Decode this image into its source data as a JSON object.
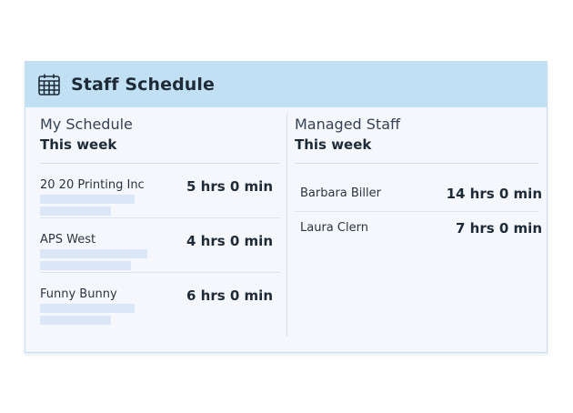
{
  "header": {
    "title": "Staff Schedule",
    "icon": "calendar-icon"
  },
  "my_schedule": {
    "title": "My Schedule",
    "subtitle": "This week",
    "items": [
      {
        "name": "20 20 Printing Inc",
        "time": "5 hrs 0 min"
      },
      {
        "name": "APS West",
        "time": "4 hrs 0 min"
      },
      {
        "name": "Funny Bunny",
        "time": "6 hrs 0 min"
      }
    ]
  },
  "managed_staff": {
    "title": "Managed Staff",
    "subtitle": "This week",
    "items": [
      {
        "name": "Barbara Biller",
        "time": "14 hrs 0 min"
      },
      {
        "name": "Laura Clern",
        "time": "7 hrs 0 min"
      }
    ]
  },
  "colors": {
    "header_bg": "#c2e0f4",
    "card_bg": "#f4f8fd",
    "placeholder": "#dbe7f6"
  }
}
